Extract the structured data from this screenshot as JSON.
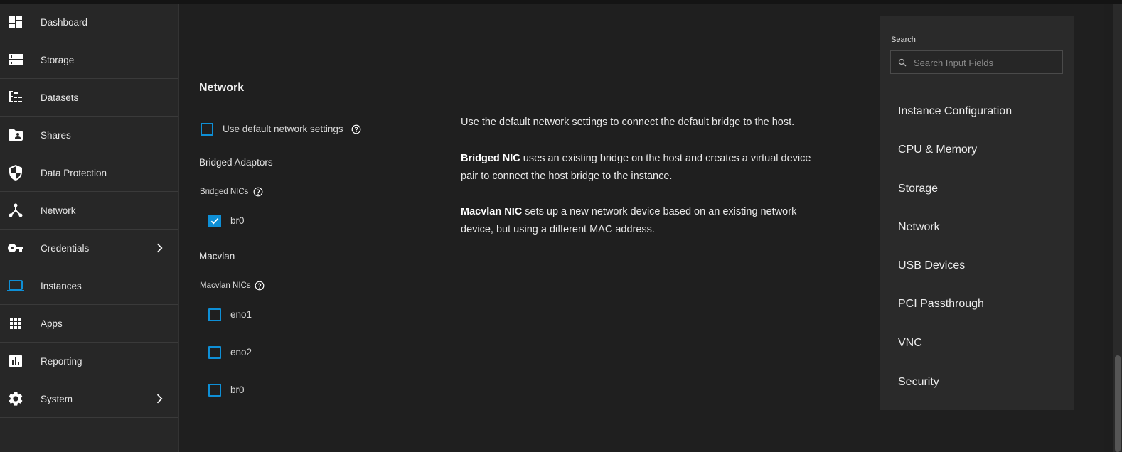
{
  "sidebar": {
    "items": [
      {
        "label": "Dashboard",
        "icon": "dashboard-icon"
      },
      {
        "label": "Storage",
        "icon": "storage-icon"
      },
      {
        "label": "Datasets",
        "icon": "datasets-icon"
      },
      {
        "label": "Shares",
        "icon": "shares-icon"
      },
      {
        "label": "Data Protection",
        "icon": "shield-icon"
      },
      {
        "label": "Network",
        "icon": "network-icon"
      },
      {
        "label": "Credentials",
        "icon": "key-icon"
      },
      {
        "label": "Instances",
        "icon": "laptop-icon",
        "active": true
      },
      {
        "label": "Apps",
        "icon": "apps-grid-icon"
      },
      {
        "label": "Reporting",
        "icon": "bar-chart-icon"
      },
      {
        "label": "System",
        "icon": "gear-icon"
      }
    ]
  },
  "network": {
    "title": "Network",
    "use_default_label": "Use default network settings",
    "use_default_checked": false,
    "bridged_heading": "Bridged Adaptors",
    "bridged_nics_label": "Bridged NICs",
    "bridged_nics": [
      {
        "label": "br0",
        "checked": true
      }
    ],
    "macvlan_heading": "Macvlan",
    "macvlan_nics_label": "Macvlan NICs",
    "macvlan_nics": [
      {
        "label": "eno1",
        "checked": false
      },
      {
        "label": "eno2",
        "checked": false
      },
      {
        "label": "br0",
        "checked": false
      }
    ]
  },
  "help_text": {
    "p1": "Use the default network settings to connect the default bridge to the host.",
    "p2_bold": "Bridged NIC",
    "p2_rest": " uses an existing bridge on the host and creates a virtual device pair to connect the host bridge to the instance.",
    "p3_bold": "Macvlan NIC",
    "p3_rest": " sets up a new network device based on an existing network device, but using a different MAC address."
  },
  "right_panel": {
    "search_label": "Search",
    "search_placeholder": "Search Input Fields",
    "search_value": "",
    "sections": [
      "Instance Configuration",
      "CPU & Memory",
      "Storage",
      "Network",
      "USB Devices",
      "PCI Passthrough",
      "VNC",
      "Security"
    ]
  },
  "colors": {
    "accent": "#0e8fd6",
    "background": "#1f1f1f",
    "sidebar": "#272727",
    "panel": "#2a2a2a"
  }
}
